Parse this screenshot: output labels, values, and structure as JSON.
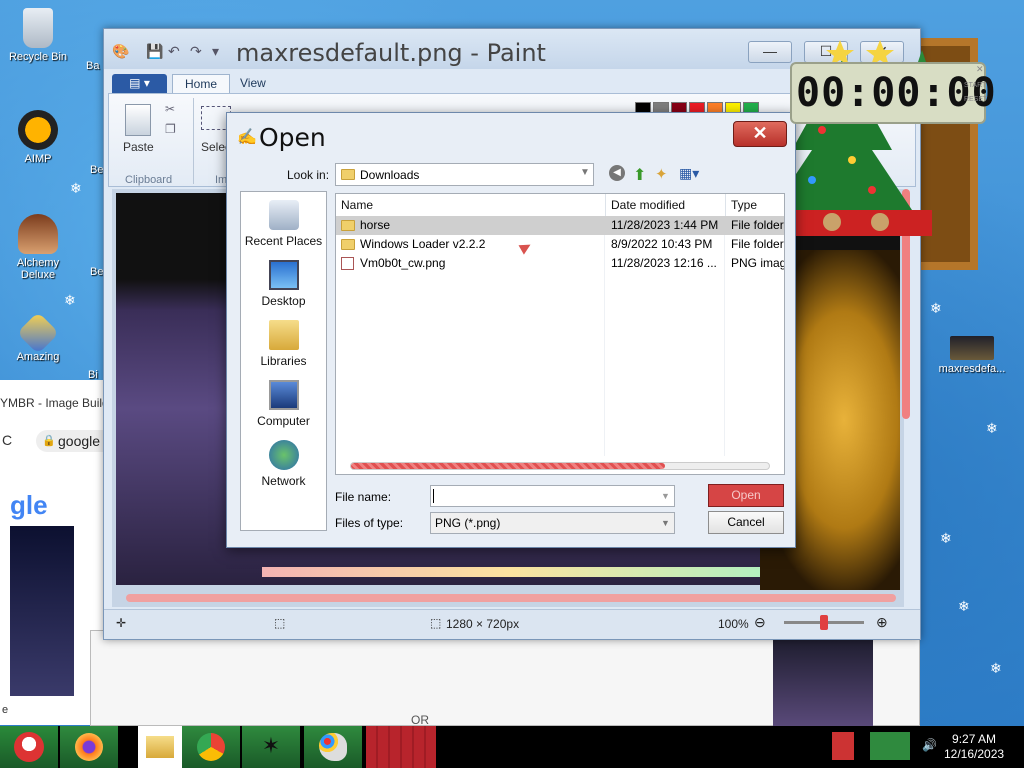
{
  "desktop": {
    "icons": [
      {
        "label": "Recycle Bin"
      },
      {
        "label": "AIMP"
      },
      {
        "label": "Alchemy Deluxe"
      },
      {
        "label": "Amazing"
      },
      {
        "label": "maxresdefa..."
      }
    ],
    "partial_labels": [
      "Ba",
      "Be",
      "Be",
      "Bi"
    ],
    "browser": {
      "title": "YMBR - Image Builde",
      "address": "google",
      "logo": "gle",
      "or_text": "OR",
      "bottom_text": "e"
    }
  },
  "paint": {
    "title": "maxresdefault.png - Paint",
    "file_tab": "▾",
    "tabs": [
      {
        "label": "Home",
        "active": true
      },
      {
        "label": "View",
        "active": false
      }
    ],
    "groups": {
      "clipboard": {
        "label": "Clipboard",
        "paste_label": "Paste"
      },
      "image": {
        "label": "Ima",
        "select_label": "Select"
      }
    },
    "status": {
      "dimensions": "1280 × 720px",
      "zoom": "100%"
    },
    "colors": [
      "#000000",
      "#7f7f7f",
      "#880015",
      "#ed1c24",
      "#ff7f27",
      "#fff200",
      "#22b14c"
    ]
  },
  "open_dialog": {
    "title": "Open",
    "close_label": "✕",
    "look_in_label": "Look in:",
    "look_in_value": "Downloads",
    "places": [
      {
        "label": "Recent Places",
        "icon": "recent-places-icon"
      },
      {
        "label": "Desktop",
        "icon": "desktop-icon"
      },
      {
        "label": "Libraries",
        "icon": "libraries-icon"
      },
      {
        "label": "Computer",
        "icon": "computer-icon"
      },
      {
        "label": "Network",
        "icon": "network-icon"
      }
    ],
    "columns": [
      "Name",
      "Date modified",
      "Type"
    ],
    "files": [
      {
        "name": "horse",
        "date": "11/28/2023 1:44 PM",
        "type": "File folder",
        "kind": "folder",
        "selected": true
      },
      {
        "name": "Windows Loader v2.2.2",
        "date": "8/9/2022 10:43 PM",
        "type": "File folder",
        "kind": "folder",
        "selected": false
      },
      {
        "name": "Vm0b0t_cw.png",
        "date": "11/28/2023 12:16 ...",
        "type": "PNG imag",
        "kind": "png",
        "selected": false
      }
    ],
    "file_name_label": "File name:",
    "file_name_value": "",
    "file_type_label": "Files of type:",
    "file_type_value": "PNG (*.png)",
    "open_label": "Open",
    "cancel_label": "Cancel"
  },
  "clock": {
    "digits": "00:00:00",
    "side_top": "START",
    "side_bottom": "RESET"
  },
  "taskbar": {
    "time": "9:27 AM",
    "date": "12/16/2023",
    "items": [
      "santa-start-icon",
      "firefox-icon",
      "explorer-icon",
      "chrome-icon",
      "game-icon",
      "paint-icon",
      "red-app-icon"
    ]
  }
}
